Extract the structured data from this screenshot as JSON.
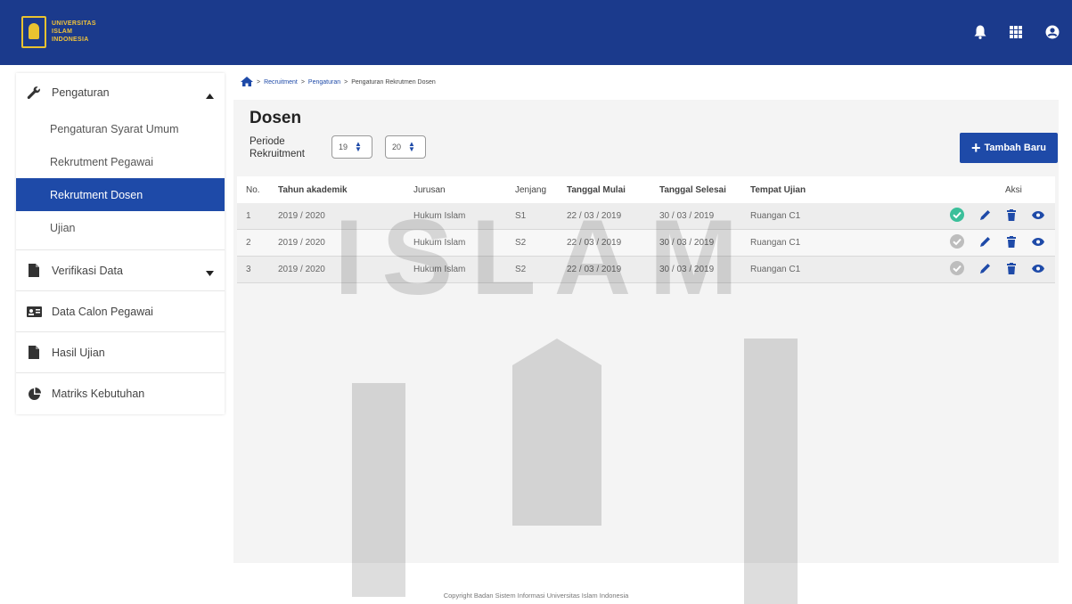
{
  "header": {
    "logo_lines": [
      "UNIVERSITAS",
      "ISLAM",
      "INDONESIA"
    ],
    "icons": [
      "bell-icon",
      "apps-grid-icon",
      "user-circle-icon"
    ]
  },
  "sidebar": {
    "group": {
      "label": "Pengaturan",
      "icon": "wrench-icon",
      "items": [
        {
          "label": "Pengaturan Syarat Umum",
          "active": false
        },
        {
          "label": "Rekrutment Pegawai",
          "active": false
        },
        {
          "label": "Rekrutment Dosen",
          "active": true
        },
        {
          "label": "Ujian",
          "active": false
        }
      ]
    },
    "items": [
      {
        "label": "Verifikasi Data",
        "icon": "document-icon"
      },
      {
        "label": "Data Calon Pegawai",
        "icon": "id-card-icon"
      },
      {
        "label": "Hasil Ujian",
        "icon": "document-icon"
      },
      {
        "label": "Matriks Kebutuhan",
        "icon": "pie-chart-icon"
      }
    ]
  },
  "breadcrumb": {
    "home_icon": "home-icon",
    "items": [
      "Recruitment",
      "Pengaturan",
      "Pengaturan Rekrutmen Dosen"
    ],
    "separator": ">"
  },
  "main": {
    "title": "Dosen",
    "periode_label": "Periode Rekruitment",
    "select_from": "19",
    "select_to": "20",
    "add_button": "Tambah Baru"
  },
  "table": {
    "headers": [
      "No.",
      "Tahun akademik",
      "Jurusan",
      "Jenjang",
      "Tanggal Mulai",
      "Tanggal Selesai",
      "Tempat Ujian",
      "Aksi"
    ],
    "rows": [
      {
        "no": "1",
        "tahun": "2019 / 2020",
        "jurusan": "Hukum Islam",
        "jenjang": "S1",
        "mulai": "22 / 03 / 2019",
        "selesai": "30 / 03 / 2019",
        "tempat": "Ruangan C1",
        "active": true
      },
      {
        "no": "2",
        "tahun": "2019 / 2020",
        "jurusan": "Hukum Islam",
        "jenjang": "S2",
        "mulai": "22 / 03 / 2019",
        "selesai": "30 / 03 / 2019",
        "tempat": "Ruangan C1",
        "active": false
      },
      {
        "no": "3",
        "tahun": "2019 / 2020",
        "jurusan": "Hukum Islam",
        "jenjang": "S2",
        "mulai": "22 / 03 / 2019",
        "selesai": "30 / 03 / 2019",
        "tempat": "Ruangan C1",
        "active": false
      }
    ]
  },
  "footer": {
    "text": "Copyright Badan Sistem Informasi Universitas Islam Indonesia"
  },
  "watermark": {
    "text": "ISLAM"
  },
  "colors": {
    "header": "#1b3a8c",
    "accent": "#1e4aa8",
    "active_check": "#3bbf9a",
    "inactive_check": "#bdbdbd"
  }
}
